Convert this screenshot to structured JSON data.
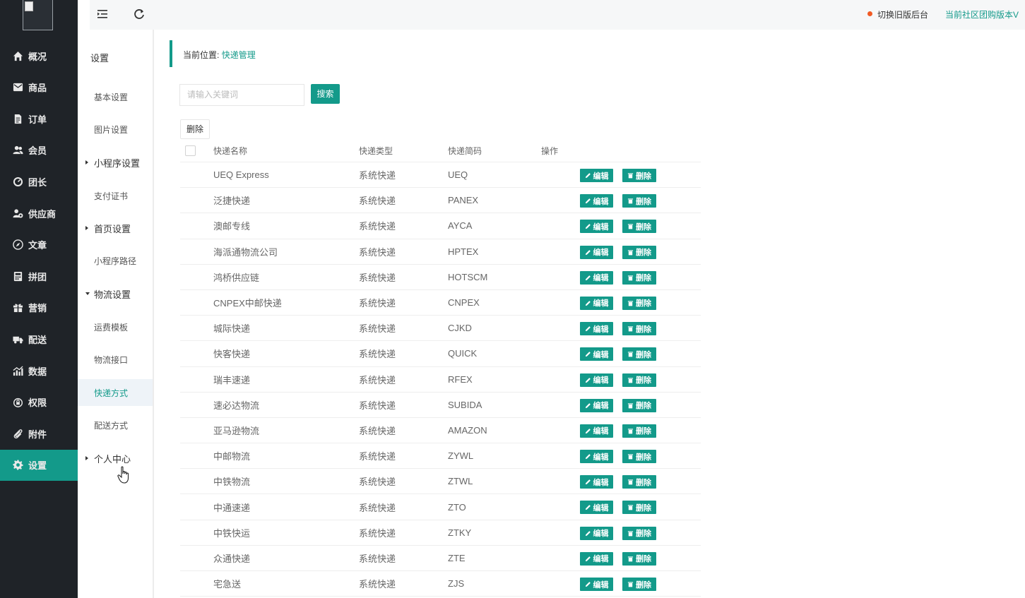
{
  "sidebar": {
    "items": [
      {
        "label": "概况",
        "icon": "home-icon"
      },
      {
        "label": "商品",
        "icon": "mail-icon"
      },
      {
        "label": "订单",
        "icon": "document-icon"
      },
      {
        "label": "会员",
        "icon": "users-icon"
      },
      {
        "label": "团长",
        "icon": "dashboard-icon"
      },
      {
        "label": "供应商",
        "icon": "supplier-icon"
      },
      {
        "label": "文章",
        "icon": "compass-icon"
      },
      {
        "label": "拼团",
        "icon": "calculator-icon"
      },
      {
        "label": "营销",
        "icon": "gift-icon"
      },
      {
        "label": "配送",
        "icon": "truck-icon"
      },
      {
        "label": "数据",
        "icon": "chart-icon"
      },
      {
        "label": "权限",
        "icon": "lock-icon"
      },
      {
        "label": "附件",
        "icon": "paperclip-icon"
      },
      {
        "label": "设置",
        "icon": "gear-icon",
        "active": true
      }
    ]
  },
  "topbar": {
    "switch_label": "切换旧版后台",
    "version_label": "当前社区团购版本V"
  },
  "subnav": {
    "title": "设置",
    "items": [
      {
        "label": "基本设置"
      },
      {
        "label": "图片设置"
      },
      {
        "label": "小程序设置",
        "group": true,
        "expanded": false
      },
      {
        "label": "支付证书"
      },
      {
        "label": "首页设置",
        "group": true,
        "expanded": false
      },
      {
        "label": "小程序路径"
      },
      {
        "label": "物流设置",
        "group": true,
        "expanded": true
      },
      {
        "label": "运费模板"
      },
      {
        "label": "物流接口"
      },
      {
        "label": "快递方式",
        "active": true
      },
      {
        "label": "配送方式"
      },
      {
        "label": "个人中心",
        "group": true,
        "expanded": false
      }
    ]
  },
  "breadcrumb": {
    "prefix": "当前位置:",
    "current": "快递管理"
  },
  "search": {
    "placeholder": "请输入关键词",
    "button_label": "搜索"
  },
  "bulk_delete_label": "删除",
  "table": {
    "columns": [
      "快递名称",
      "快递类型",
      "快递简码",
      "操作"
    ],
    "edit_label": "编辑",
    "delete_label": "删除",
    "rows": [
      {
        "name": "UEQ Express",
        "type": "系统快递",
        "code": "UEQ"
      },
      {
        "name": "泛捷快递",
        "type": "系统快递",
        "code": "PANEX"
      },
      {
        "name": "澳邮专线",
        "type": "系统快递",
        "code": "AYCA"
      },
      {
        "name": "海派通物流公司",
        "type": "系统快递",
        "code": "HPTEX"
      },
      {
        "name": "鸿桥供应链",
        "type": "系统快递",
        "code": "HOTSCM"
      },
      {
        "name": "CNPEX中邮快递",
        "type": "系统快递",
        "code": "CNPEX"
      },
      {
        "name": "城际快递",
        "type": "系统快递",
        "code": "CJKD"
      },
      {
        "name": "快客快递",
        "type": "系统快递",
        "code": "QUICK"
      },
      {
        "name": "瑞丰速递",
        "type": "系统快递",
        "code": "RFEX"
      },
      {
        "name": "速必达物流",
        "type": "系统快递",
        "code": "SUBIDA"
      },
      {
        "name": "亚马逊物流",
        "type": "系统快递",
        "code": "AMAZON"
      },
      {
        "name": "中邮物流",
        "type": "系统快递",
        "code": "ZYWL"
      },
      {
        "name": "中铁物流",
        "type": "系统快递",
        "code": "ZTWL"
      },
      {
        "name": "中通速递",
        "type": "系统快递",
        "code": "ZTO"
      },
      {
        "name": "中铁快运",
        "type": "系统快递",
        "code": "ZTKY"
      },
      {
        "name": "众通快递",
        "type": "系统快递",
        "code": "ZTE"
      },
      {
        "name": "宅急送",
        "type": "系统快递",
        "code": "ZJS"
      }
    ]
  },
  "colors": {
    "accent": "#139a8a",
    "sidebar_bg": "#1f2328",
    "alert_dot": "#f15a24"
  }
}
